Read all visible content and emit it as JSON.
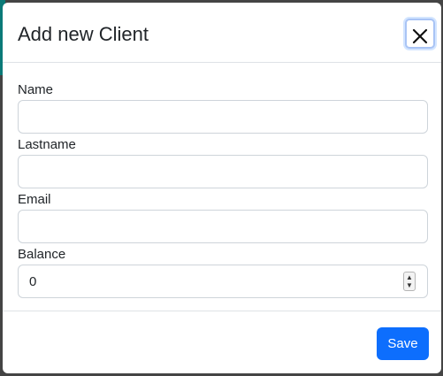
{
  "modal": {
    "title": "Add new Client",
    "close_icon": "close-icon"
  },
  "form": {
    "fields": [
      {
        "label": "Name",
        "value": ""
      },
      {
        "label": "Lastname",
        "value": ""
      },
      {
        "label": "Email",
        "value": ""
      },
      {
        "label": "Balance",
        "value": "0"
      }
    ]
  },
  "footer": {
    "save_label": "Save"
  },
  "colors": {
    "accent": "#0d6efd",
    "border": "#ced4da",
    "text": "#212529"
  }
}
